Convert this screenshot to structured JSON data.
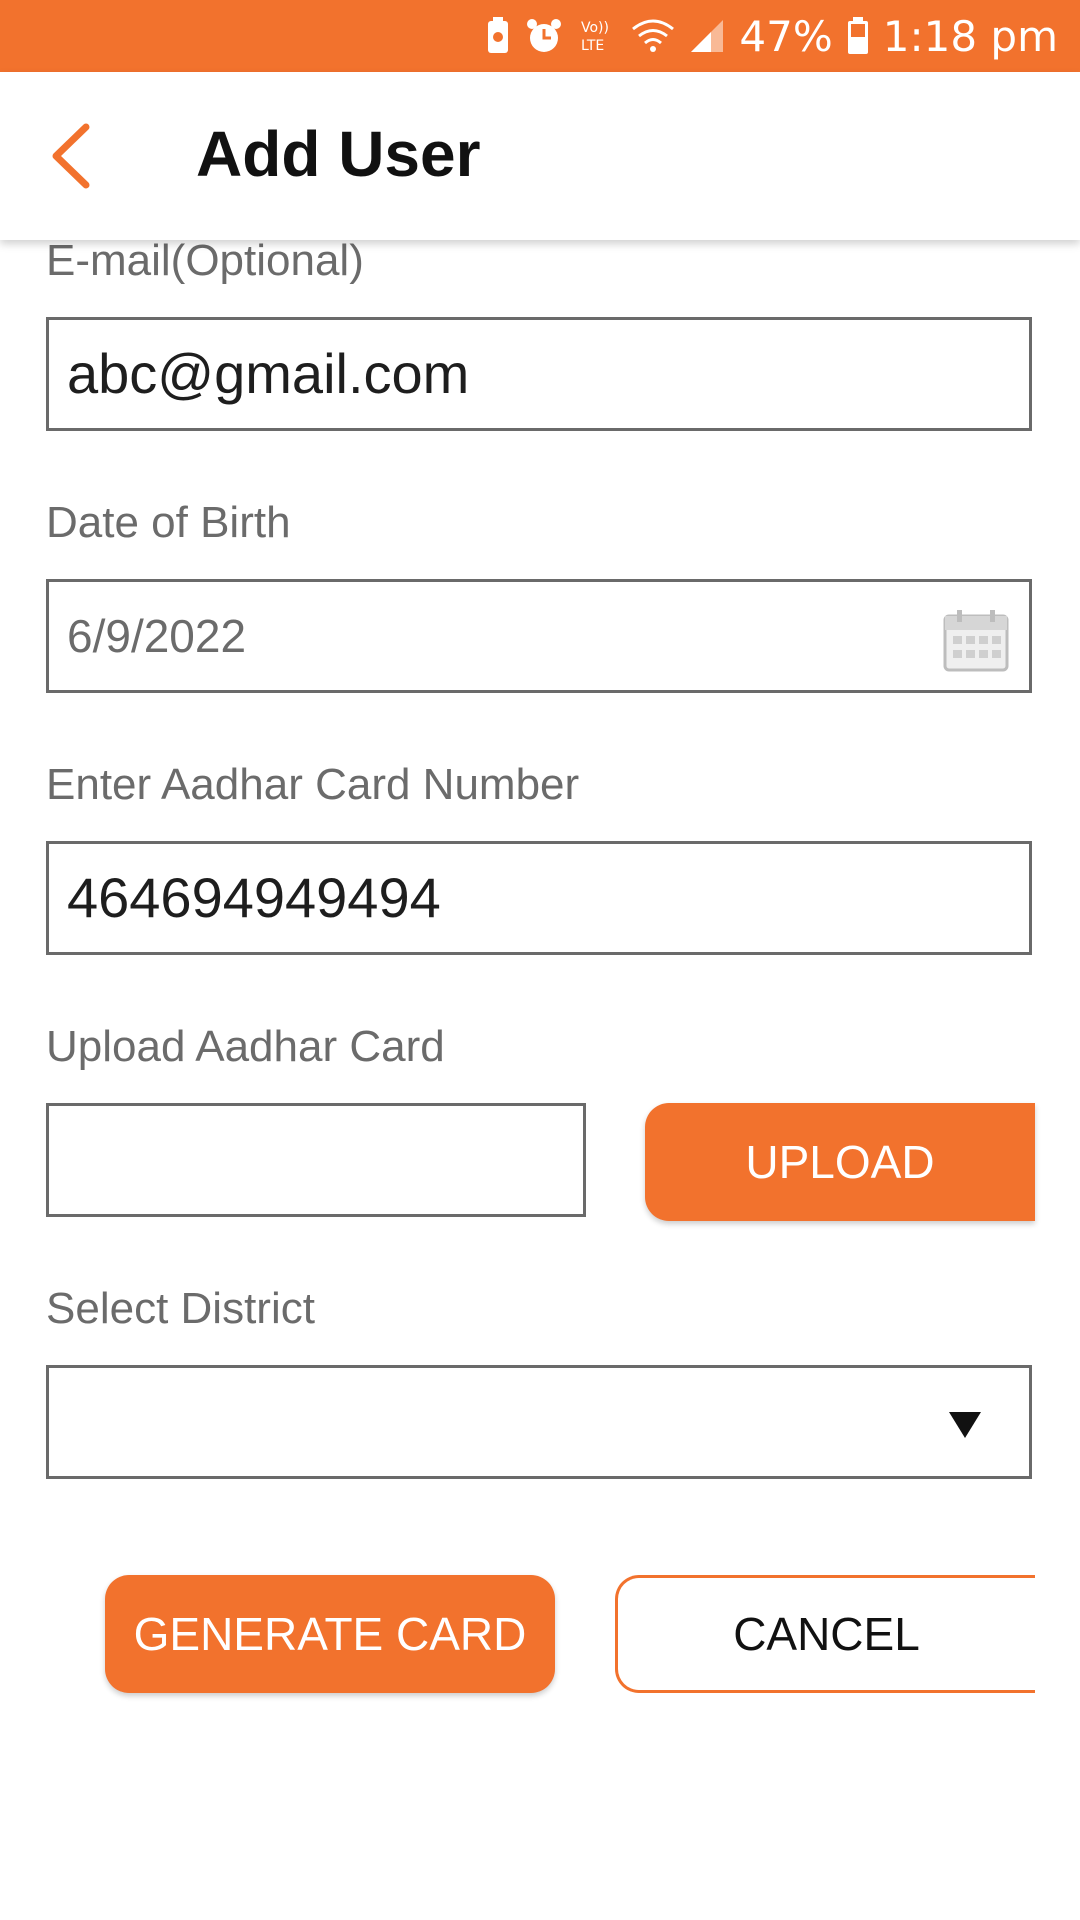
{
  "status_bar": {
    "battery": "47%",
    "time": "1:18 pm",
    "icons": [
      "battery-saver-icon",
      "alarm-icon",
      "volte-icon",
      "wifi-icon",
      "signal-icon",
      "battery-icon"
    ],
    "volte_text": "Vo)) LTE"
  },
  "app_bar": {
    "title": "Add User",
    "back_icon": "back-arrow-icon"
  },
  "form": {
    "email": {
      "label": "E-mail(Optional)",
      "value": "abc@gmail.com"
    },
    "dob": {
      "label": "Date of Birth",
      "value": "6/9/2022",
      "icon": "calendar-icon"
    },
    "aadhar_number": {
      "label": "Enter Aadhar Card Number",
      "value": "464694949494"
    },
    "upload_aadhar": {
      "label": "Upload Aadhar Card",
      "value": "",
      "button_label": "UPLOAD"
    },
    "district": {
      "label": "Select District",
      "value": "",
      "icon": "dropdown-arrow-icon"
    }
  },
  "actions": {
    "generate_label": "GENERATE CARD",
    "cancel_label": "CANCEL"
  },
  "colors": {
    "accent": "#F2722D",
    "border": "#6A6A6A",
    "label": "#6B6B6B"
  }
}
